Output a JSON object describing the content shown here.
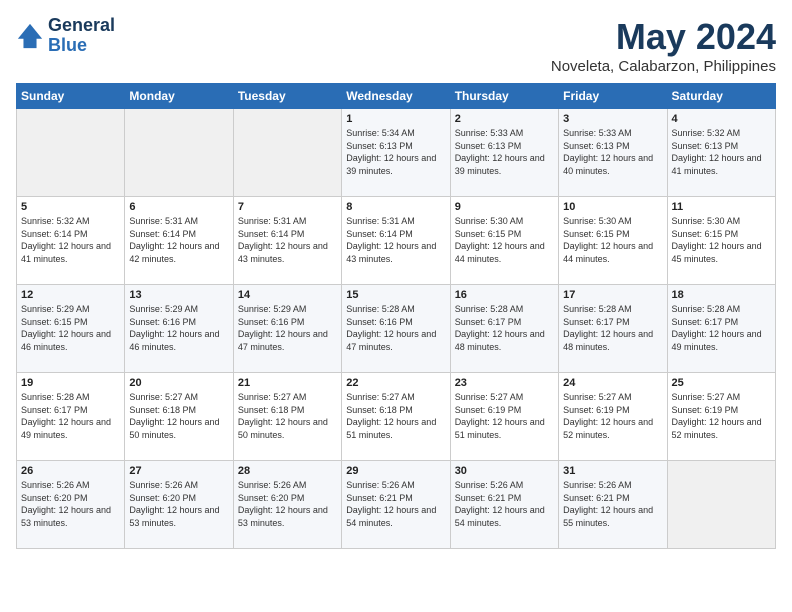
{
  "header": {
    "logo_line1": "General",
    "logo_line2": "Blue",
    "title": "May 2024",
    "subtitle": "Noveleta, Calabarzon, Philippines"
  },
  "weekdays": [
    "Sunday",
    "Monday",
    "Tuesday",
    "Wednesday",
    "Thursday",
    "Friday",
    "Saturday"
  ],
  "weeks": [
    [
      {
        "day": "",
        "sunrise": "",
        "sunset": "",
        "daylight": "",
        "empty": true
      },
      {
        "day": "",
        "sunrise": "",
        "sunset": "",
        "daylight": "",
        "empty": true
      },
      {
        "day": "",
        "sunrise": "",
        "sunset": "",
        "daylight": "",
        "empty": true
      },
      {
        "day": "1",
        "sunrise": "Sunrise: 5:34 AM",
        "sunset": "Sunset: 6:13 PM",
        "daylight": "Daylight: 12 hours and 39 minutes."
      },
      {
        "day": "2",
        "sunrise": "Sunrise: 5:33 AM",
        "sunset": "Sunset: 6:13 PM",
        "daylight": "Daylight: 12 hours and 39 minutes."
      },
      {
        "day": "3",
        "sunrise": "Sunrise: 5:33 AM",
        "sunset": "Sunset: 6:13 PM",
        "daylight": "Daylight: 12 hours and 40 minutes."
      },
      {
        "day": "4",
        "sunrise": "Sunrise: 5:32 AM",
        "sunset": "Sunset: 6:13 PM",
        "daylight": "Daylight: 12 hours and 41 minutes."
      }
    ],
    [
      {
        "day": "5",
        "sunrise": "Sunrise: 5:32 AM",
        "sunset": "Sunset: 6:14 PM",
        "daylight": "Daylight: 12 hours and 41 minutes."
      },
      {
        "day": "6",
        "sunrise": "Sunrise: 5:31 AM",
        "sunset": "Sunset: 6:14 PM",
        "daylight": "Daylight: 12 hours and 42 minutes."
      },
      {
        "day": "7",
        "sunrise": "Sunrise: 5:31 AM",
        "sunset": "Sunset: 6:14 PM",
        "daylight": "Daylight: 12 hours and 43 minutes."
      },
      {
        "day": "8",
        "sunrise": "Sunrise: 5:31 AM",
        "sunset": "Sunset: 6:14 PM",
        "daylight": "Daylight: 12 hours and 43 minutes."
      },
      {
        "day": "9",
        "sunrise": "Sunrise: 5:30 AM",
        "sunset": "Sunset: 6:15 PM",
        "daylight": "Daylight: 12 hours and 44 minutes."
      },
      {
        "day": "10",
        "sunrise": "Sunrise: 5:30 AM",
        "sunset": "Sunset: 6:15 PM",
        "daylight": "Daylight: 12 hours and 44 minutes."
      },
      {
        "day": "11",
        "sunrise": "Sunrise: 5:30 AM",
        "sunset": "Sunset: 6:15 PM",
        "daylight": "Daylight: 12 hours and 45 minutes."
      }
    ],
    [
      {
        "day": "12",
        "sunrise": "Sunrise: 5:29 AM",
        "sunset": "Sunset: 6:15 PM",
        "daylight": "Daylight: 12 hours and 46 minutes."
      },
      {
        "day": "13",
        "sunrise": "Sunrise: 5:29 AM",
        "sunset": "Sunset: 6:16 PM",
        "daylight": "Daylight: 12 hours and 46 minutes."
      },
      {
        "day": "14",
        "sunrise": "Sunrise: 5:29 AM",
        "sunset": "Sunset: 6:16 PM",
        "daylight": "Daylight: 12 hours and 47 minutes."
      },
      {
        "day": "15",
        "sunrise": "Sunrise: 5:28 AM",
        "sunset": "Sunset: 6:16 PM",
        "daylight": "Daylight: 12 hours and 47 minutes."
      },
      {
        "day": "16",
        "sunrise": "Sunrise: 5:28 AM",
        "sunset": "Sunset: 6:17 PM",
        "daylight": "Daylight: 12 hours and 48 minutes."
      },
      {
        "day": "17",
        "sunrise": "Sunrise: 5:28 AM",
        "sunset": "Sunset: 6:17 PM",
        "daylight": "Daylight: 12 hours and 48 minutes."
      },
      {
        "day": "18",
        "sunrise": "Sunrise: 5:28 AM",
        "sunset": "Sunset: 6:17 PM",
        "daylight": "Daylight: 12 hours and 49 minutes."
      }
    ],
    [
      {
        "day": "19",
        "sunrise": "Sunrise: 5:28 AM",
        "sunset": "Sunset: 6:17 PM",
        "daylight": "Daylight: 12 hours and 49 minutes."
      },
      {
        "day": "20",
        "sunrise": "Sunrise: 5:27 AM",
        "sunset": "Sunset: 6:18 PM",
        "daylight": "Daylight: 12 hours and 50 minutes."
      },
      {
        "day": "21",
        "sunrise": "Sunrise: 5:27 AM",
        "sunset": "Sunset: 6:18 PM",
        "daylight": "Daylight: 12 hours and 50 minutes."
      },
      {
        "day": "22",
        "sunrise": "Sunrise: 5:27 AM",
        "sunset": "Sunset: 6:18 PM",
        "daylight": "Daylight: 12 hours and 51 minutes."
      },
      {
        "day": "23",
        "sunrise": "Sunrise: 5:27 AM",
        "sunset": "Sunset: 6:19 PM",
        "daylight": "Daylight: 12 hours and 51 minutes."
      },
      {
        "day": "24",
        "sunrise": "Sunrise: 5:27 AM",
        "sunset": "Sunset: 6:19 PM",
        "daylight": "Daylight: 12 hours and 52 minutes."
      },
      {
        "day": "25",
        "sunrise": "Sunrise: 5:27 AM",
        "sunset": "Sunset: 6:19 PM",
        "daylight": "Daylight: 12 hours and 52 minutes."
      }
    ],
    [
      {
        "day": "26",
        "sunrise": "Sunrise: 5:26 AM",
        "sunset": "Sunset: 6:20 PM",
        "daylight": "Daylight: 12 hours and 53 minutes."
      },
      {
        "day": "27",
        "sunrise": "Sunrise: 5:26 AM",
        "sunset": "Sunset: 6:20 PM",
        "daylight": "Daylight: 12 hours and 53 minutes."
      },
      {
        "day": "28",
        "sunrise": "Sunrise: 5:26 AM",
        "sunset": "Sunset: 6:20 PM",
        "daylight": "Daylight: 12 hours and 53 minutes."
      },
      {
        "day": "29",
        "sunrise": "Sunrise: 5:26 AM",
        "sunset": "Sunset: 6:21 PM",
        "daylight": "Daylight: 12 hours and 54 minutes."
      },
      {
        "day": "30",
        "sunrise": "Sunrise: 5:26 AM",
        "sunset": "Sunset: 6:21 PM",
        "daylight": "Daylight: 12 hours and 54 minutes."
      },
      {
        "day": "31",
        "sunrise": "Sunrise: 5:26 AM",
        "sunset": "Sunset: 6:21 PM",
        "daylight": "Daylight: 12 hours and 55 minutes."
      },
      {
        "day": "",
        "sunrise": "",
        "sunset": "",
        "daylight": "",
        "empty": true
      }
    ]
  ]
}
